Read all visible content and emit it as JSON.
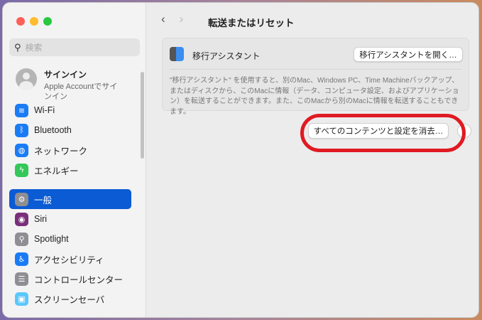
{
  "sidebar": {
    "search_placeholder": "検索",
    "account": {
      "title": "サインイン",
      "subtitle": "Apple Accountでサインイン"
    },
    "items": [
      {
        "label": "Wi-Fi",
        "icon": "wifi-icon",
        "color": "#1a7cf5"
      },
      {
        "label": "Bluetooth",
        "icon": "bluetooth-icon",
        "color": "#1a7cf5"
      },
      {
        "label": "ネットワーク",
        "icon": "globe-icon",
        "color": "#1a7cf5"
      },
      {
        "label": "エネルギー",
        "icon": "bolt-icon",
        "color": "#34c759"
      },
      {
        "label": "一般",
        "icon": "gear-icon",
        "color": "#8e8e93",
        "selected": true
      },
      {
        "label": "Siri",
        "icon": "siri-icon",
        "color": "#7a2f7a"
      },
      {
        "label": "Spotlight",
        "icon": "magnifier-icon",
        "color": "#8e8e93"
      },
      {
        "label": "アクセシビリティ",
        "icon": "accessibility-icon",
        "color": "#1a7cf5"
      },
      {
        "label": "コントロールセンター",
        "icon": "control-center-icon",
        "color": "#8e8e93"
      },
      {
        "label": "スクリーンセーバ",
        "icon": "screensaver-icon",
        "color": "#5ac8fa"
      }
    ]
  },
  "header": {
    "back": "‹",
    "forward": "›",
    "title": "転送またはリセット"
  },
  "migration": {
    "label": "移行アシスタント",
    "open_button": "移行アシスタントを開く…",
    "description": "\"移行アシスタント\" を使用すると、別のMac、Windows PC、Time Machineバックアップ、またはディスクから、このMacに情報（データ、コンピュータ設定、およびアプリケーション）を転送することができます。また、このMacから別のMacに情報を転送することもできます。"
  },
  "erase_button": "すべてのコンテンツと設定を消去…",
  "highlight_color": "#e01a22"
}
